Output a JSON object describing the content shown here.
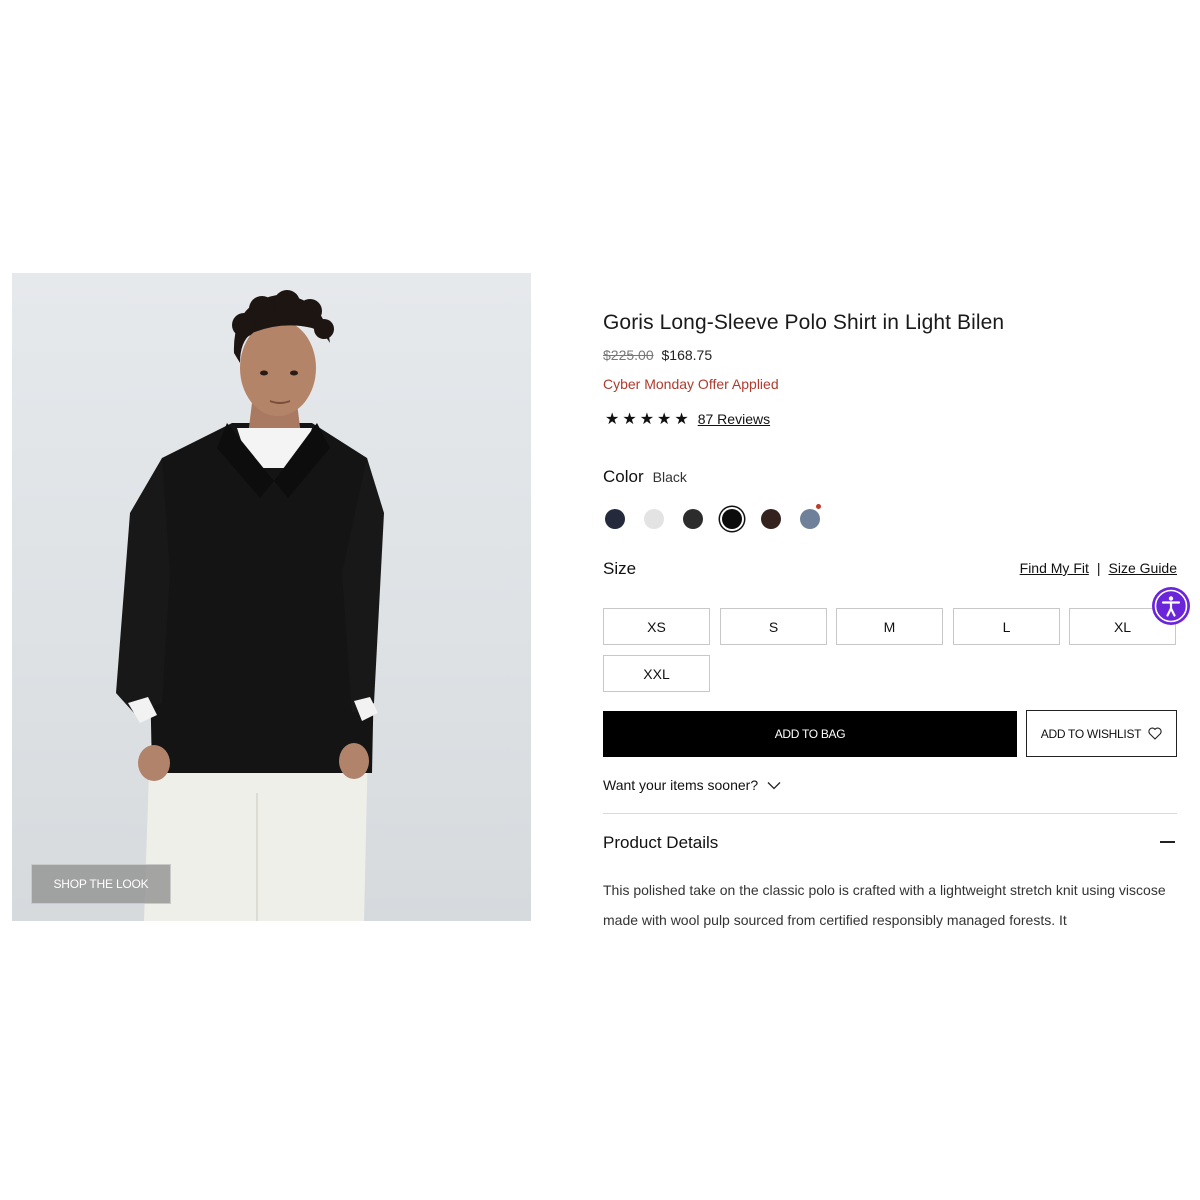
{
  "product": {
    "title": "Goris Long-Sleeve Polo Shirt in Light Bilen",
    "original_price": "$225.00",
    "sale_price": "$168.75",
    "offer_text": "Cyber Monday Offer Applied",
    "rating": {
      "stars": "★★★★★",
      "value": 5,
      "reviews_label": "87 Reviews"
    }
  },
  "image": {
    "shop_the_look_label": "SHOP THE LOOK"
  },
  "color": {
    "label": "Color",
    "selected_name": "Black",
    "swatches": [
      {
        "hex": "#242a3c",
        "selected": false
      },
      {
        "hex": "#e3e3e3",
        "selected": false
      },
      {
        "hex": "#2c2c2c",
        "selected": false
      },
      {
        "hex": "#0c0c0c",
        "selected": true
      },
      {
        "hex": "#34221f",
        "selected": false
      },
      {
        "hex": "#6f819a",
        "selected": false,
        "marker": true
      }
    ],
    "marker_color": "#c0392b"
  },
  "size": {
    "label": "Size",
    "find_my_fit": "Find My Fit",
    "separator": "|",
    "size_guide": "Size Guide",
    "options": [
      "XS",
      "S",
      "M",
      "L",
      "XL",
      "XXL"
    ]
  },
  "actions": {
    "add_to_bag": "ADD TO BAG",
    "add_to_wishlist": "ADD TO WISHLIST",
    "want_sooner": "Want your items sooner?"
  },
  "details": {
    "heading": "Product Details",
    "body": "This polished take on the classic polo is crafted with a lightweight stretch knit using viscose made with wool pulp sourced from certified responsibly managed forests. It"
  },
  "colors": {
    "accent": "#000000",
    "offer": "#b03a2e",
    "accessibility": "#6a24d9"
  },
  "icons": [
    "heart-icon",
    "chevron-down-icon",
    "minus-icon",
    "accessibility-icon",
    "star-icon"
  ]
}
